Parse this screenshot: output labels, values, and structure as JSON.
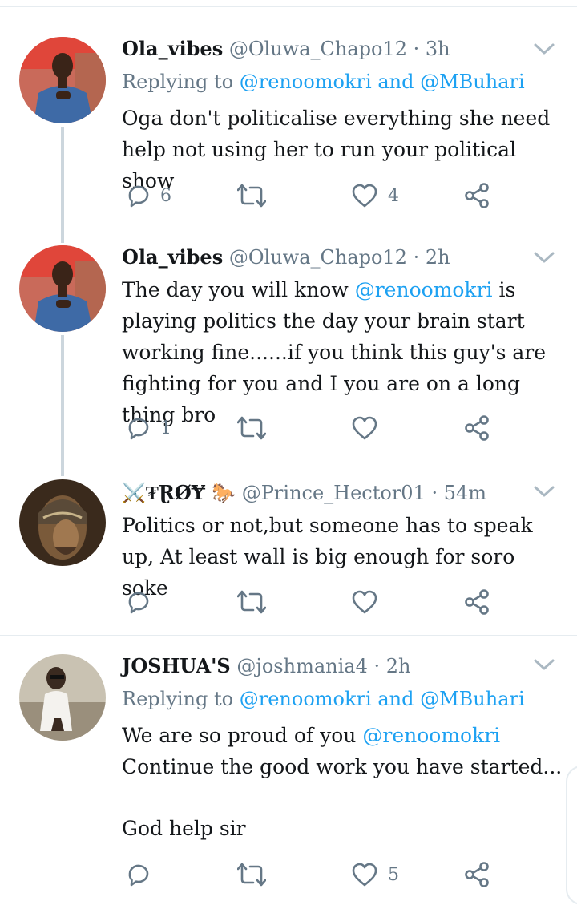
{
  "tweets": [
    {
      "name": "Ola_vibes",
      "handle": "@Oluwa_Chapo12",
      "time": "· 3h",
      "replying_label": "Replying to",
      "replying_a": "@renoomokri",
      "replying_and": "and",
      "replying_b": "@MBuhari",
      "text": "Oga don't politicalise everything she need help not using her to run your political show",
      "replies": "6",
      "retweets": "",
      "likes": "4"
    },
    {
      "name": "Ola_vibes",
      "handle": "@Oluwa_Chapo12",
      "time": "· 2h",
      "text_pre": "The day you will know",
      "mention": "@renoomokri",
      "text_post": "is playing politics the day your brain start working fine......if you think this guy's are fighting for you and I you are on a long thing bro",
      "replies": "1",
      "retweets": "",
      "likes": ""
    },
    {
      "name": "⚔️₮ⱤØɎ 🐎",
      "handle": "@Prince_Hector01",
      "time": "· 54m",
      "text": "Politics or not,but someone has to speak up, At least wall is big enough for soro soke",
      "replies": "",
      "retweets": "",
      "likes": ""
    },
    {
      "name": "JOSHUA'S",
      "handle": "@joshmania4",
      "time": "· 2h",
      "replying_label": "Replying to",
      "replying_a": "@renoomokri",
      "replying_and": "and",
      "replying_b": "@MBuhari",
      "text_pre": "We are so proud of you",
      "mention": "@renoomokri",
      "text_post": "Continue the good work you have started...",
      "text_extra": "God help sir",
      "replies": "",
      "retweets": "",
      "likes": "5"
    }
  ],
  "colors": {
    "link": "#1da1f2",
    "secondary": "#657786",
    "divider": "#e6ecf0",
    "thread": "#ccd6dd"
  },
  "icons": [
    "reply-icon",
    "retweet-icon",
    "like-icon",
    "share-icon",
    "chevron-down-icon"
  ]
}
